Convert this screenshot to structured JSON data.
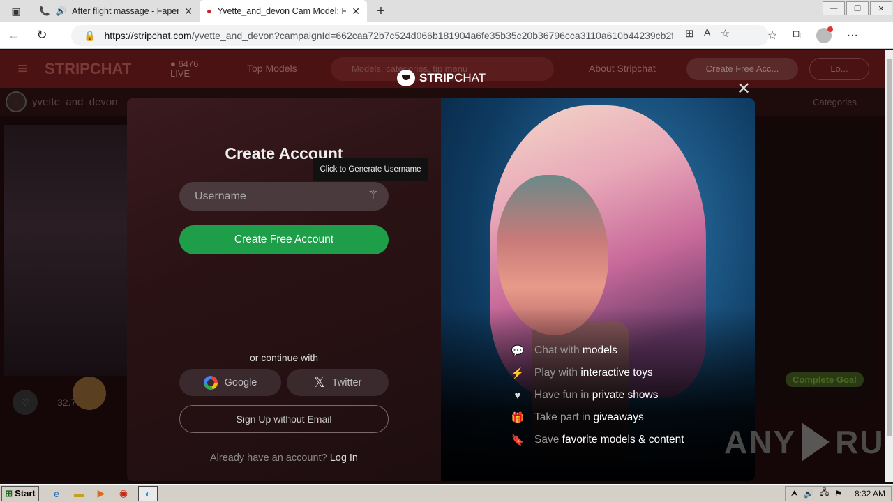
{
  "browser": {
    "tabs": [
      {
        "title": "After flight massage - Faper",
        "close": "✕"
      },
      {
        "title": "Yvette_and_devon Cam Model: F",
        "close": "✕"
      }
    ],
    "new_tab": "+",
    "url_host": "https://stripchat.com",
    "url_path": "/yvette_and_devon?campaignId=662caa72b7c524d066b181904a6fe35b35c20b36796cca3110a610b44239cb2f..."
  },
  "site": {
    "logo": "STRIPCHAT",
    "live_count": "6476",
    "live_label": "LIVE",
    "top_models": "Top Models",
    "search_placeholder": "Models, categories, tip menu",
    "about": "About Stripchat",
    "create_btn": "Create Free Acc...",
    "login_btn": "Lo...",
    "model_name": "yvette_and_devon",
    "categories": "Categories",
    "likes": "32.7k",
    "goal": "Complete Goal"
  },
  "modal": {
    "logo_bold": "STRIP",
    "logo_light": "CHAT",
    "title": "Create Account",
    "tooltip": "Click to Generate Username",
    "username_placeholder": "Username",
    "create_button": "Create Free Account",
    "or_continue": "or continue with",
    "google": "Google",
    "twitter": "Twitter",
    "no_email": "Sign Up without Email",
    "already": "Already have an account?",
    "login": "Log In",
    "features": [
      {
        "pre": "Chat with ",
        "hl": "models",
        "post": "",
        "icon": "chat-icon"
      },
      {
        "pre": "Play with ",
        "hl": "interactive toys",
        "post": "",
        "icon": "toy-icon"
      },
      {
        "pre": "Have fun in ",
        "hl": "private shows",
        "post": "",
        "icon": "heart-icon"
      },
      {
        "pre": "Take part in ",
        "hl": "giveaways",
        "post": "",
        "icon": "gift-icon"
      },
      {
        "pre": "Save ",
        "hl": "favorite models & content",
        "post": "",
        "icon": "bookmark-icon"
      }
    ]
  },
  "watermark": {
    "left": "ANY",
    "right": "RUN"
  },
  "taskbar": {
    "start": "Start",
    "time": "8:32 AM"
  }
}
